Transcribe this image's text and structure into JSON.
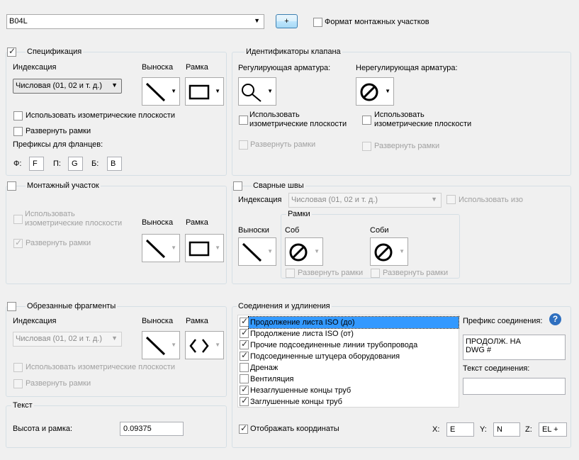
{
  "top": {
    "combo_value": "B04L",
    "plus_label": "+",
    "format_label": "Формат монтажных участков"
  },
  "spec": {
    "title": "Спецификация",
    "indexing_label": "Индексация",
    "indexing_value": "Числовая (01, 02 и т. д.)",
    "callout_label": "Выноска",
    "frame_label": "Рамка",
    "use_iso": "Использовать изометрические плоскости",
    "expand_frames": "Развернуть рамки",
    "flange_prefixes": "Префиксы для фланцев:",
    "f_label": "Ф:",
    "f_value": "F",
    "p_label": "П:",
    "p_value": "G",
    "b_label": "Б:",
    "b_value": "B"
  },
  "valve": {
    "title": "Идентификаторы клапана",
    "regulating": "Регулирующая арматура:",
    "non_regulating": "Нерегулирующая арматура:",
    "use_iso_1": "Использовать",
    "use_iso_2": "изометрические плоскости",
    "expand_frames": "Развернуть рамки"
  },
  "spool": {
    "title": "Монтажный участок",
    "use_iso_1": "Использовать",
    "use_iso_2": "изометрические плоскости",
    "expand_frames": "Развернуть рамки",
    "callout_label": "Выноска",
    "frame_label": "Рамка"
  },
  "welds": {
    "title": "Сварные швы",
    "indexing_label": "Индексация",
    "indexing_value": "Числовая (01, 02 и т. д.)",
    "use_iso": "Использовать изо",
    "frames_title": "Рамки",
    "callout_label": "Выноски",
    "sob_label": "Соб",
    "sobi_label": "Соби",
    "expand_1": "Развернуть рамки",
    "expand_2": "Развернуть рамки"
  },
  "cut": {
    "title": "Обрезанные фрагменты",
    "indexing_label": "Индексация",
    "indexing_value": "Числовая (01, 02 и т. д.)",
    "callout_label": "Выноска",
    "frame_label": "Рамка",
    "use_iso": "Использовать изометрические плоскости",
    "expand_frames": "Развернуть рамки"
  },
  "text": {
    "title": "Текст",
    "height_label": "Высота и рамка:",
    "height_value": "0.09375"
  },
  "conn": {
    "title": "Соединения и удлинения",
    "items": [
      {
        "label": "Продолжение листа ISO (до)",
        "checked": true
      },
      {
        "label": "Продолжение листа ISO (от)",
        "checked": true
      },
      {
        "label": "Прочие подсоединенные линии трубопровода",
        "checked": true
      },
      {
        "label": "Подсоединенные штуцера оборудования",
        "checked": true
      },
      {
        "label": "Дренаж",
        "checked": false
      },
      {
        "label": "Вентиляция",
        "checked": false
      },
      {
        "label": "Незаглушенные концы труб",
        "checked": true
      },
      {
        "label": "Заглушенные концы труб",
        "checked": true
      }
    ],
    "prefix_label": "Префикс соединения:",
    "prefix_value": "ПРОДОЛЖ. НА\nDWG #",
    "text_label": "Текст соединения:",
    "text_value": "",
    "show_coords": "Отображать координаты",
    "x_label": "X:",
    "x_value": "E",
    "y_label": "Y:",
    "y_value": "N",
    "z_label": "Z:",
    "z_value": "EL +"
  },
  "icons": {
    "check": "✓",
    "arrow": "▼"
  }
}
